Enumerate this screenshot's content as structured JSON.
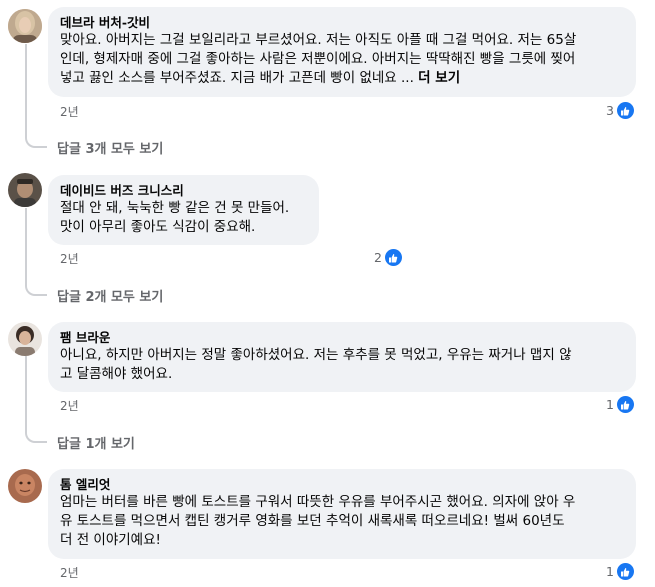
{
  "comments": [
    {
      "author": "데브라 버처-갓비",
      "lines": [
        "맞아요. 아버지는 그걸 보일리라고 부르셨어요. 저는 아직도 아플 때 그걸 먹어요. 저는 65살",
        "인데, 형제자매 중에 그걸 좋아하는 사람은 저뿐이에요. 아버지는 딱딱해진 빵을 그릇에 찢어",
        "넣고 끓인 소스를 부어주셨죠. 지금 배가 고픈데 빵이 없네요 ..."
      ],
      "see_more": "더 보기",
      "age": "2년",
      "reaction_count": "3",
      "view_replies": "답글 3개 모두 보기"
    },
    {
      "author": "데이비드 버즈 크니스리",
      "lines": [
        "절대 안 돼, 눅눅한 빵 같은 건 못 만들어.",
        "맛이 아무리 좋아도 식감이 중요해."
      ],
      "age": "2년",
      "reaction_count": "2",
      "view_replies": "답글 2개 모두 보기"
    },
    {
      "author": "팸 브라운",
      "lines": [
        "아니요, 하지만 아버지는 정말 좋아하셨어요. 저는 후추를 못 먹었고, 우유는 짜거나 맵지 않",
        "고 달콤해야 했어요."
      ],
      "age": "2년",
      "reaction_count": "1",
      "view_replies": "답글 1개 보기"
    },
    {
      "author": "톰 엘리엇",
      "lines": [
        "엄마는 버터를 바른 빵에 토스트를 구워서 따뜻한 우유를 부어주시곤 했어요. 의자에 앉아 우",
        "유 토스트를 먹으면서 캡틴 캥거루 영화를 보던 추억이 새록새록 떠오르네요! 벌써 60년도",
        "더 전 이야기예요!"
      ],
      "age": "2년",
      "reaction_count": "1"
    }
  ],
  "icons": {
    "reaction": "thumbs-up-like-icon"
  },
  "colors": {
    "like_blue": "#1877f2",
    "bubble_bg": "#f0f2f5",
    "meta_gray": "#65676b"
  }
}
